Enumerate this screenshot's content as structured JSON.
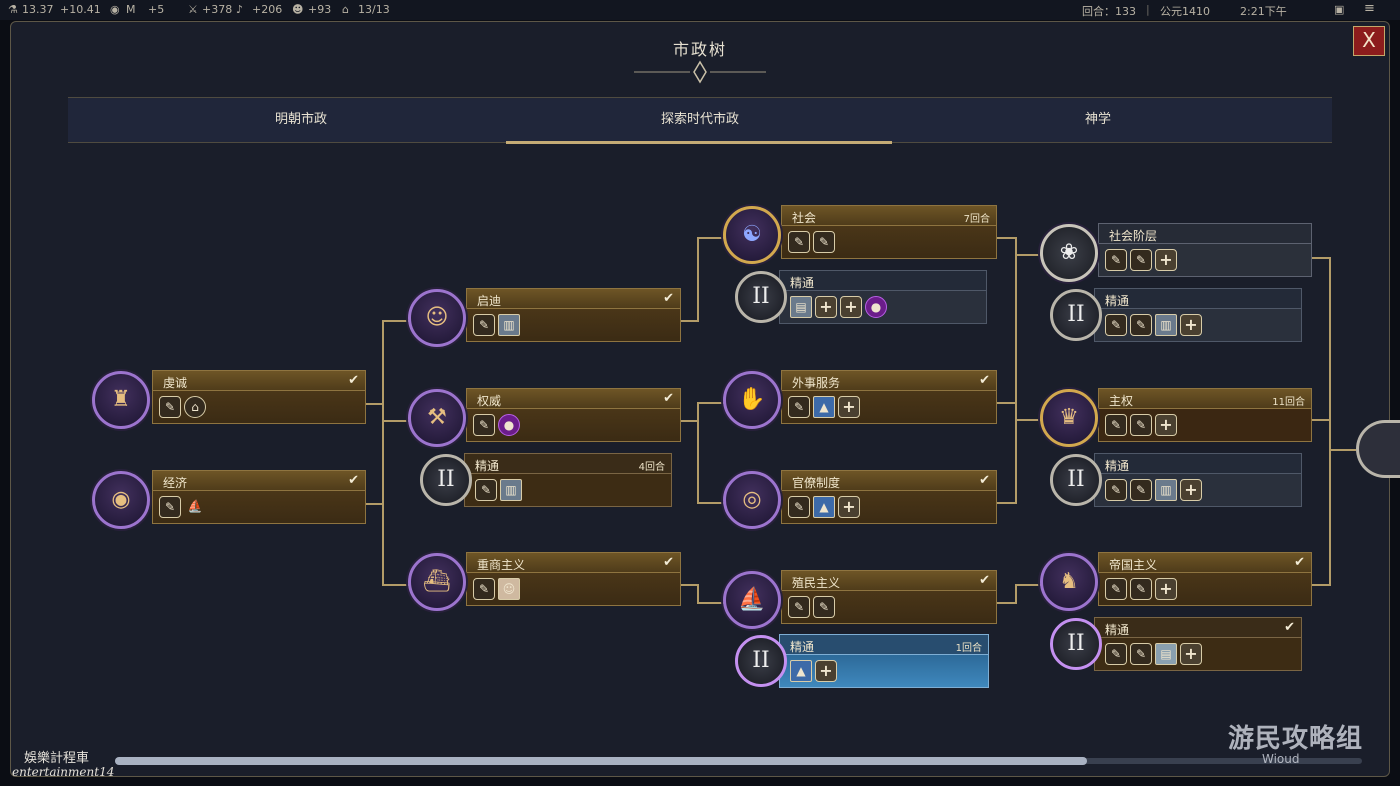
{
  "top_bar": {
    "stats": [
      {
        "icon": "science-icon",
        "value": "13.37"
      },
      {
        "icon": "culture-icon",
        "value": "+10.41"
      },
      {
        "icon": "gold-icon",
        "value": "M"
      },
      {
        "icon": "influence-icon",
        "value": "+5"
      },
      {
        "icon": "military-icon",
        "value": "+378"
      },
      {
        "icon": "happiness-icon",
        "value": "+206"
      },
      {
        "icon": "faith-icon",
        "value": "+93"
      },
      {
        "icon": "population-icon",
        "value": "13/13"
      }
    ],
    "turn_label": "回合：133",
    "year_label": "公元1410",
    "clock": "2:21下午",
    "menu_icon": "menu-icon"
  },
  "title": "市政树",
  "close_label": "X",
  "tabs": [
    {
      "label": "明朝市政"
    },
    {
      "label": "探索时代市政"
    },
    {
      "label": "神学"
    }
  ],
  "nodes": {
    "qiancheng": {
      "name": "虔诚",
      "icon": "temple-icon"
    },
    "jingji": {
      "name": "经济",
      "icon": "coins-icon"
    },
    "qidi": {
      "name": "启迪",
      "icon": "scholar-bust-icon"
    },
    "quanwei": {
      "name": "权威",
      "icon": "gavel-icon"
    },
    "quanwei_m": {
      "label": "精通",
      "turns": "4回合"
    },
    "zhongshang": {
      "name": "重商主义",
      "icon": "merchant-ship-icon"
    },
    "shehui": {
      "name": "社会",
      "turns": "7回合",
      "icon": "theater-masks-icon"
    },
    "shehui_m": {
      "label": "精通"
    },
    "waishi": {
      "name": "外事服务",
      "icon": "handshake-icon"
    },
    "guanliao": {
      "name": "官僚制度",
      "icon": "coins-pile-icon"
    },
    "zhimin": {
      "name": "殖民主义",
      "icon": "sail-ship-icon"
    },
    "zhimin_m": {
      "label": "精通",
      "turns": "1回合"
    },
    "shehuijieceng": {
      "name": "社会阶层",
      "icon": "ruff-collar-icon"
    },
    "shehuijieceng_m": {
      "label": "精通"
    },
    "zhuquan": {
      "name": "主权",
      "turns": "11回合",
      "icon": "crown-icon"
    },
    "zhuquan_m": {
      "label": "精通"
    },
    "diguo": {
      "name": "帝国主义",
      "icon": "war-horn-icon"
    },
    "diguo_m": {
      "label": "精通"
    }
  },
  "mastery_numeral": "II",
  "watermark": {
    "line1": "娛樂計程車",
    "line2": "entertainment14",
    "logo": "游民攻略组",
    "logo_sub": "Wioud"
  },
  "colors": {
    "node_gold": "#6e5526",
    "badge_purple": "#9c74ce",
    "mastery_active": "#3f88bd",
    "tab_underline": "#c4ab75",
    "close_red": "#8c1c1c"
  }
}
